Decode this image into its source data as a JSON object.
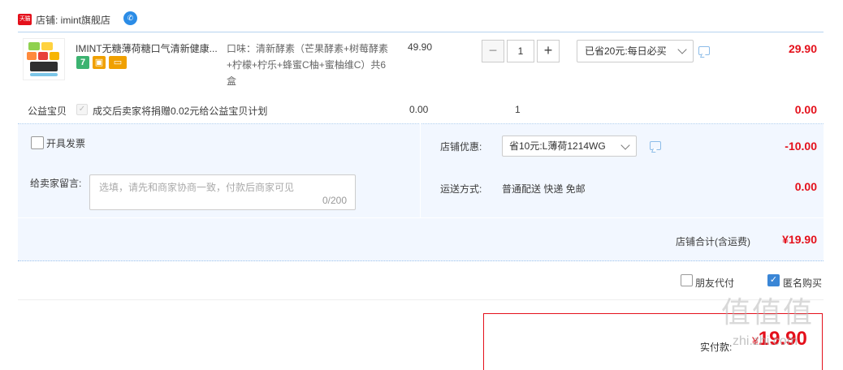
{
  "shop": {
    "badge_text": "天猫",
    "label": "店铺: imint旗舰店",
    "chat_icon": "chat-bubble-icon"
  },
  "product": {
    "name": "IMINT无糖薄荷糖口气清新健康...",
    "sku": "口味：清新酵素（芒果酵素+树莓酵素+柠檬+柠乐+蜂蜜C柚+蜜柚维C）共6盒",
    "unit_price": "49.90",
    "quantity": "1",
    "qty_minus": "−",
    "qty_plus": "+",
    "coupon": "已省20元:每日必买",
    "total": "29.90",
    "service_icons": [
      {
        "name": "7-day-return-icon",
        "text": "7",
        "color": "#3cb371"
      },
      {
        "name": "guarantee-icon",
        "text": "▣",
        "color": "#f0a000"
      },
      {
        "name": "credit-card-icon",
        "text": "▭",
        "color": "#f0a000"
      }
    ]
  },
  "charity": {
    "title": "公益宝贝",
    "text": "成交后卖家将捐赠0.02元给公益宝贝计划",
    "price": "0.00",
    "qty": "1",
    "total": "0.00"
  },
  "options": {
    "invoice_label": "开具发票",
    "note_label": "给卖家留言:",
    "note_placeholder": "选填，请先和商家协商一致，付款后商家可见",
    "note_count": "0/200",
    "shop_discount_label": "店铺优惠:",
    "shop_discount_value": "省10元:L薄荷1214WG",
    "shop_discount_amount": "-10.00",
    "shipping_label": "运送方式:",
    "shipping_text": "普通配送 快递 免邮",
    "shipping_amount": "0.00"
  },
  "subtotal": {
    "label": "店铺合计(含运费)",
    "amount": "¥19.90"
  },
  "bottom": {
    "friend_pay": "朋友代付",
    "anonymous": "匿名购买",
    "actual_pay_label": "实付款:",
    "actual_pay_yen": "¥",
    "actual_pay_amount": "19.90"
  },
  "watermark": {
    "big": "值值值",
    "small": "zhi.zhi.com"
  },
  "colors": {
    "accent_red": "#e4101b",
    "panel_blue": "#f2f7ff",
    "border_blue": "#b7d3f0",
    "checkbox_blue": "#3a86d6"
  }
}
